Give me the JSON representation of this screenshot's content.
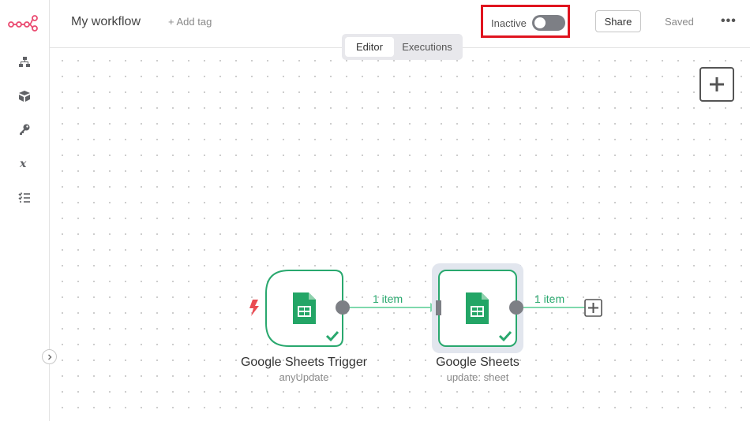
{
  "header": {
    "workflow_name": "My workflow",
    "add_tag": "+ Add tag",
    "status_label": "Inactive",
    "share_label": "Share",
    "saved_label": "Saved",
    "more_label": "•••"
  },
  "tabs": [
    {
      "label": "Editor",
      "active": true
    },
    {
      "label": "Executions",
      "active": false
    }
  ],
  "sidebar": {
    "items": [
      {
        "icon": "workflows-icon"
      },
      {
        "icon": "templates-icon"
      },
      {
        "icon": "credentials-icon"
      },
      {
        "icon": "variables-icon"
      },
      {
        "icon": "executions-icon"
      }
    ]
  },
  "nodes": [
    {
      "title": "Google Sheets Trigger",
      "subtitle": "anyUpdate",
      "icon": "google-sheets-icon",
      "trigger": true,
      "status": "success"
    },
    {
      "title": "Google Sheets",
      "subtitle": "update: sheet",
      "icon": "google-sheets-icon",
      "trigger": false,
      "status": "success"
    }
  ],
  "connections": [
    {
      "label": "1 item"
    },
    {
      "label": "1 item"
    }
  ],
  "colors": {
    "accent": "#ea4b71",
    "success": "#29a86e",
    "highlight": "#e0141f"
  }
}
